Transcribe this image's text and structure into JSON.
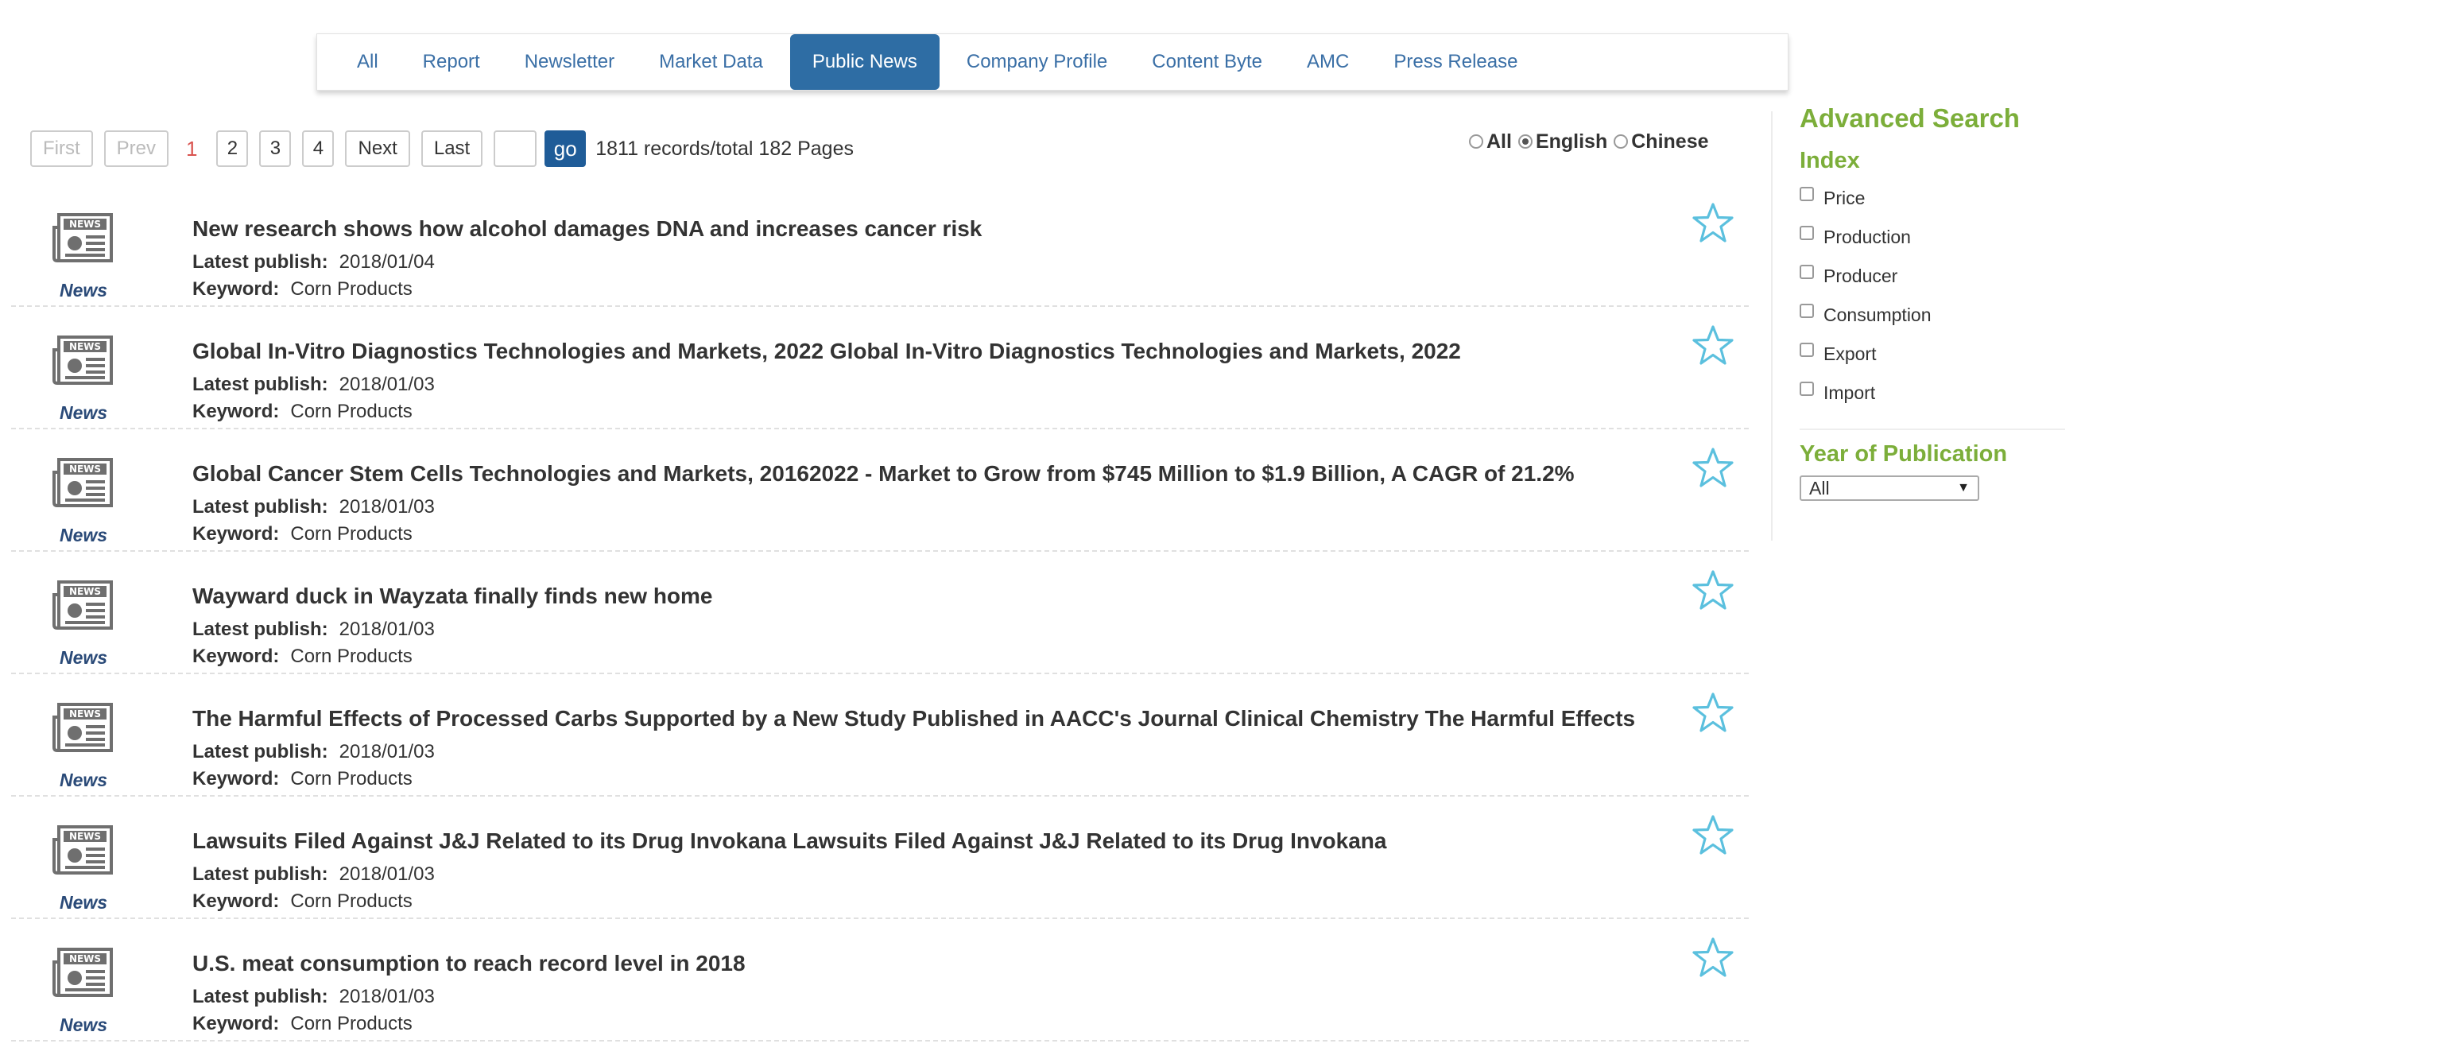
{
  "tabs": [
    {
      "label": "All"
    },
    {
      "label": "Report"
    },
    {
      "label": "Newsletter"
    },
    {
      "label": "Market Data"
    },
    {
      "label": "Public News",
      "active": true
    },
    {
      "label": "Company Profile"
    },
    {
      "label": "Content Byte"
    },
    {
      "label": "AMC"
    },
    {
      "label": "Press Release"
    }
  ],
  "pager": {
    "first": "First",
    "prev": "Prev",
    "current": "1",
    "pages": [
      "2",
      "3",
      "4"
    ],
    "next": "Next",
    "last": "Last",
    "go": "go",
    "records": "1811 records/total 182 Pages"
  },
  "language": {
    "options": [
      {
        "label": "All",
        "selected": false
      },
      {
        "label": "English",
        "selected": true
      },
      {
        "label": "Chinese",
        "selected": false
      }
    ]
  },
  "list": {
    "type_label": "News",
    "publish_label": "Latest publish:",
    "keyword_label": "Keyword:",
    "items": [
      {
        "title": "New research shows how alcohol damages DNA and increases cancer risk",
        "date": "2018/01/04",
        "keyword": "Corn Products"
      },
      {
        "title": "Global In-Vitro Diagnostics Technologies and Markets, 2022 Global In-Vitro Diagnostics Technologies and Markets, 2022",
        "date": "2018/01/03",
        "keyword": "Corn Products"
      },
      {
        "title": "Global Cancer Stem Cells Technologies and Markets, 20162022 - Market to Grow from $745 Million to $1.9 Billion, A CAGR of 21.2%",
        "date": "2018/01/03",
        "keyword": "Corn Products"
      },
      {
        "title": "Wayward duck in Wayzata finally finds new home",
        "date": "2018/01/03",
        "keyword": "Corn Products"
      },
      {
        "title": "The Harmful Effects of Processed Carbs Supported by a New Study Published in AACC's Journal Clinical Chemistry The Harmful Effects",
        "date": "2018/01/03",
        "keyword": "Corn Products"
      },
      {
        "title": "Lawsuits Filed Against J&J Related to its Drug Invokana Lawsuits Filed Against J&J Related to its Drug Invokana",
        "date": "2018/01/03",
        "keyword": "Corn Products"
      },
      {
        "title": "U.S. meat consumption to reach record level in 2018",
        "date": "2018/01/03",
        "keyword": "Corn Products"
      }
    ]
  },
  "sidebar": {
    "title": "Advanced Search",
    "index_title": "Index",
    "index_options": [
      "Price",
      "Production",
      "Producer",
      "Consumption",
      "Export",
      "Import"
    ],
    "year_title": "Year of Publication",
    "year_selected": "All"
  },
  "colors": {
    "accent_green": "#7cae3a",
    "tab_active": "#2e6da4",
    "link_blue": "#3a6fa6",
    "star_blue": "#5bc0de"
  },
  "icons": {
    "news": "newspaper-icon",
    "favorite": "star-outline-icon"
  }
}
